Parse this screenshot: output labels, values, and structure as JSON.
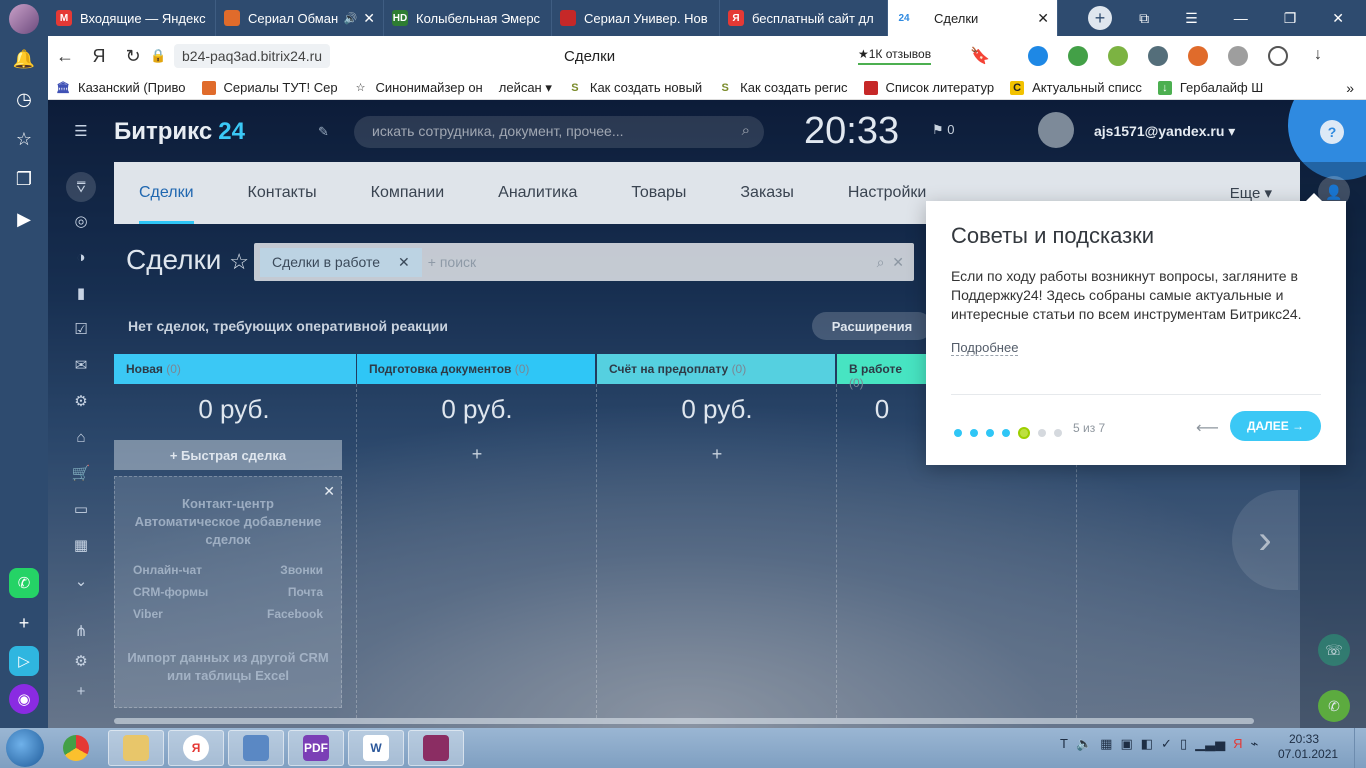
{
  "browser": {
    "tabs": [
      {
        "title": "Входящие — Яндекс",
        "favicon_color": "#e53935",
        "glyph": "M"
      },
      {
        "title": "Сериал Обман",
        "favicon_color": "#e06b2b",
        "glyph": "",
        "audio": "🔊"
      },
      {
        "title": "Колыбельная Эмерс",
        "favicon_color": "#2e7d32",
        "glyph": "HD"
      },
      {
        "title": "Сериал Универ. Нов",
        "favicon_color": "#c62828",
        "glyph": ""
      },
      {
        "title": "бесплатный сайт дл",
        "favicon_color": "#e53935",
        "glyph": "Я"
      },
      {
        "title": "Сделки",
        "favicon_color": "#2f8ae0",
        "glyph": "24",
        "active": true
      }
    ],
    "address": "b24-paq3ad.bitrix24.ru",
    "page_title": "Сделки",
    "reviews": "★1К отзывов",
    "bookmarks": [
      {
        "label": "Казанский (Приво",
        "color": "#3f51b5",
        "glyph": "🏛"
      },
      {
        "label": "Сериалы ТУТ! Сер",
        "color": "#e06b2b",
        "glyph": ""
      },
      {
        "label": "Синонимайзер он",
        "color": "#ffffff",
        "glyph": "☆"
      },
      {
        "label": "лейсан ▾",
        "color": "#ffffff",
        "glyph": ""
      },
      {
        "label": "Как создать новый",
        "color": "#7a8b2a",
        "glyph": "S"
      },
      {
        "label": "Как создать регис",
        "color": "#7a8b2a",
        "glyph": "S"
      },
      {
        "label": "Список литератур",
        "color": "#c62828",
        "glyph": "▮"
      },
      {
        "label": "Актуальный списс",
        "color": "#f2c200",
        "glyph": "C"
      },
      {
        "label": "Гербалайф Ш",
        "color": "#4caf50",
        "glyph": "↓"
      }
    ]
  },
  "bitrix": {
    "logo": "Битрикс",
    "logo_num": "24",
    "search_placeholder": "искать сотрудника, документ, прочее...",
    "clock": "20:33",
    "flag_count": "0",
    "user": "ajs1571@yandex.ru",
    "menu": [
      "Сделки",
      "Контакты",
      "Компании",
      "Аналитика",
      "Товары",
      "Заказы",
      "Настройки"
    ],
    "menu_more": "Еще ▾",
    "title": "Сделки",
    "filter_chip": "Сделки в работе",
    "filter_placeholder": "+ поиск",
    "no_deals": "Нет сделок, требующих оперативной реакции",
    "extensions_btn": "Расширения",
    "stages": [
      {
        "name": "Новая",
        "count": "(0)",
        "sum": "0 руб.",
        "color": "#3bc8f5"
      },
      {
        "name": "Подготовка документов",
        "count": "(0)",
        "sum": "0 руб.",
        "color": "#2fc6f6"
      },
      {
        "name": "Счёт на предоплату",
        "count": "(0)",
        "sum": "0 руб.",
        "color": "#55d0e0"
      },
      {
        "name": "В работе",
        "count": "(0)",
        "sum": "0",
        "color": "#47e4c2"
      }
    ],
    "quick_deal": "+ Быстрая сделка",
    "contact_center": {
      "title": "Контакт-центр Автоматическое добавление сделок",
      "items": [
        "Онлайн-чат",
        "Звонки",
        "CRM-формы",
        "Почта",
        "Viber",
        "Facebook"
      ],
      "import": "Импорт данных из другой CRM или таблицы Excel"
    }
  },
  "tips": {
    "title": "Советы и подсказки",
    "text": "Если по ходу работы возникнут вопросы, загляните в Поддержку24! Здесь собраны самые актуальные и интересные статьи по всем инструментам Битрикс24.",
    "more": "Подробнее",
    "counter": "5 из 7",
    "total": 7,
    "current": 5,
    "next": "ДАЛЕЕ →"
  },
  "taskbar": {
    "time": "20:33",
    "date": "07.01.2021"
  }
}
